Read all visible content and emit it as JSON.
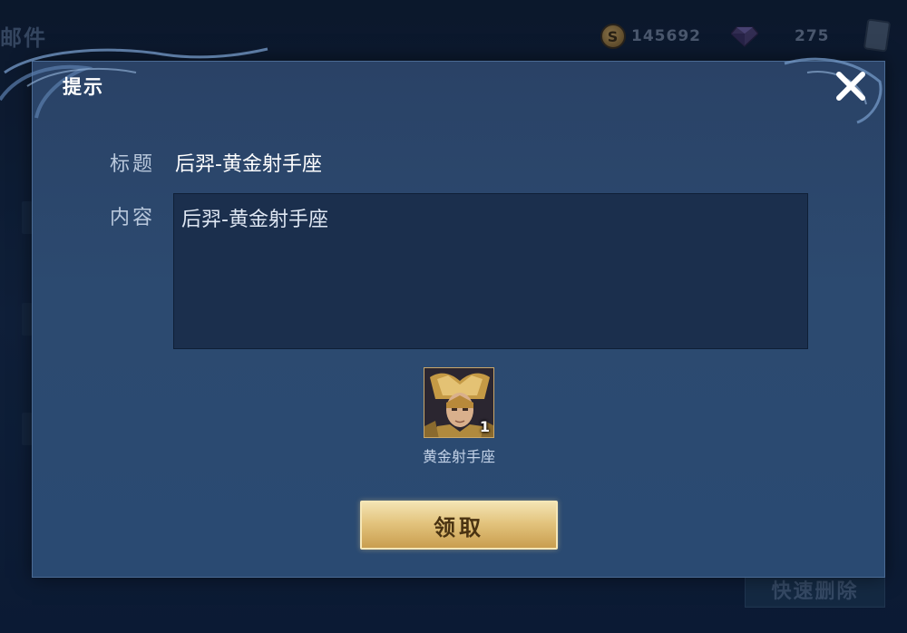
{
  "background": {
    "screen_title": "邮件",
    "gold_amount": "145692",
    "gem_amount": "275",
    "quick_delete_label": "快速删除"
  },
  "dialog": {
    "title": "提示",
    "subject_label": "标题",
    "subject_value": "后羿-黄金射手座",
    "content_label": "内容",
    "content_value": "后羿-黄金射手座",
    "reward": {
      "name": "黄金射手座",
      "count": "1",
      "icon": "hero-skin-portrait-icon"
    },
    "claim_label": "领取",
    "close_icon": "close-icon"
  },
  "colors": {
    "accent_gold": "#e3c47e",
    "dialog_bg": "#2c4a70",
    "content_bg": "#1b2f4d"
  }
}
